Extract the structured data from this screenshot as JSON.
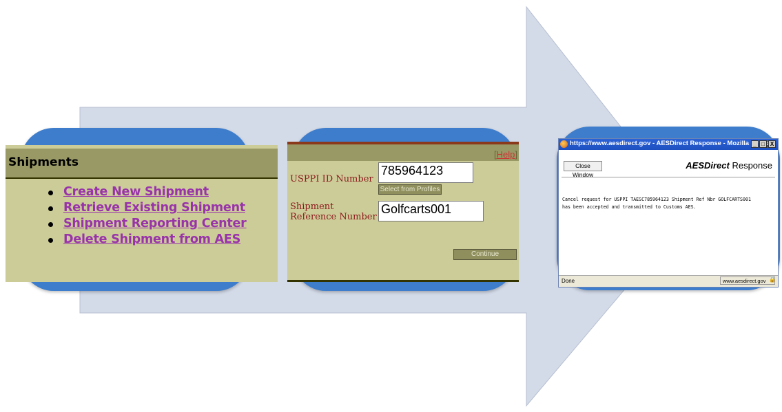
{
  "shipments_panel": {
    "title": "Shipments",
    "links": [
      "Create New Shipment",
      "Retrieve Existing Shipment",
      "Shipment Reporting Center",
      "Delete Shipment from AES"
    ]
  },
  "form_panel": {
    "help_open": "[",
    "help_label": "Help",
    "help_close": "]",
    "usppi_label": "USPPI ID Number",
    "usppi_value": "785964123",
    "select_profiles_label": "Select from Profiles",
    "shipment_ref_label": "Shipment Reference Number",
    "shipment_ref_value": "Golfcarts001",
    "continue_label": "Continue"
  },
  "firefox_window": {
    "title": "https://www.aesdirect.gov - AESDirect Response - Mozilla Firefox",
    "minimize": "_",
    "maximize": "□",
    "close": "X",
    "close_window_label": "Close Window",
    "response_prefix": "AESDirect",
    "response_suffix": " Response",
    "message_line1": "Cancel request for USPPI TAESC785964123 Shipment Ref Nbr GOLFCARTS001",
    "message_line2": "has been accepted and transmitted to Customs AES.",
    "status_text": "Done",
    "status_host": "www.aesdirect.gov"
  },
  "colors": {
    "arrow": "#d3dae8",
    "pill": "#3d7dcc",
    "panel_bg": "#cccc99",
    "panel_header": "#999966",
    "link": "#9933aa",
    "label": "#8b1a1a"
  },
  "icons": [
    "lock-icon",
    "firefox-icon",
    "bullet-icon"
  ]
}
